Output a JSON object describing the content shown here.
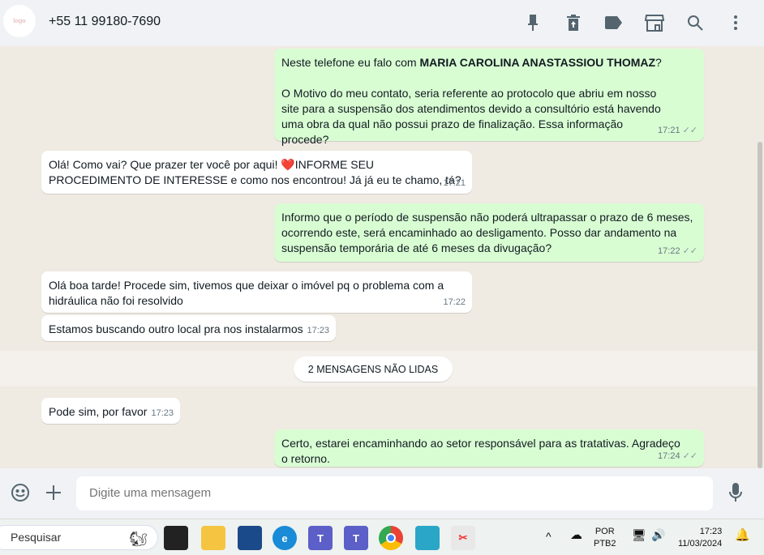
{
  "header": {
    "contact": "+55 11 99180-7690",
    "icons": [
      "pin-icon",
      "archive-icon",
      "label-icon",
      "store-icon",
      "search-icon",
      "menu-icon"
    ]
  },
  "messages": [
    {
      "dir": "out",
      "line1_prefix": "Neste telefone eu falo com ",
      "line1_bold": "MARIA CAROLINA ANASTASSIOU THOMAZ",
      "line1_suffix": "?",
      "body": "O Motivo do meu contato, seria referente ao protocolo que abriu em nosso site para a suspensão dos atendimentos devido a consultório está havendo uma obra da qual não possui prazo de finalização. Essa informação procede?",
      "time": "17:21"
    },
    {
      "dir": "in",
      "text_a": "Olá! Como vai? Que prazer ter você por aqui! ",
      "emoji": "❤️",
      "text_b": "INFORME SEU PROCEDIMENTO DE INTERESSE e como nos encontrou! Já já eu te chamo, tá?",
      "time": "17:21"
    },
    {
      "dir": "out",
      "text": "Informo que o período de suspensão não poderá ultrapassar o prazo de 6 meses, ocorrendo este, será encaminhado ao desligamento. Posso dar andamento na suspensão temporária de até 6 meses da divugação?",
      "time": "17:22"
    },
    {
      "dir": "in",
      "text": "Olá boa tarde! Procede sim, tivemos que deixar o imóvel pq o problema com a hidráulica não foi resolvido",
      "time": "17:22"
    },
    {
      "dir": "in",
      "text": "Estamos buscando outro local pra nos instalarmos",
      "time": "17:23"
    },
    {
      "dir": "in",
      "text": "Pode sim, por favor",
      "time": "17:23"
    },
    {
      "dir": "out",
      "text": "Certo, estarei encaminhando ao setor responsável para as tratativas. Agradeço o retorno.",
      "time": "17:24"
    }
  ],
  "unread_banner": "2 MENSAGENS NÃO LIDAS",
  "composer": {
    "placeholder": "Digite uma mensagem"
  },
  "taskbar": {
    "search": "Pesquisar",
    "lang1": "POR",
    "lang2": "PTB2",
    "time": "17:23",
    "date": "11/03/2024"
  },
  "colors": {
    "outgoing": "#d9fdd3",
    "incoming": "#ffffff",
    "ticks": "#8696a0"
  }
}
